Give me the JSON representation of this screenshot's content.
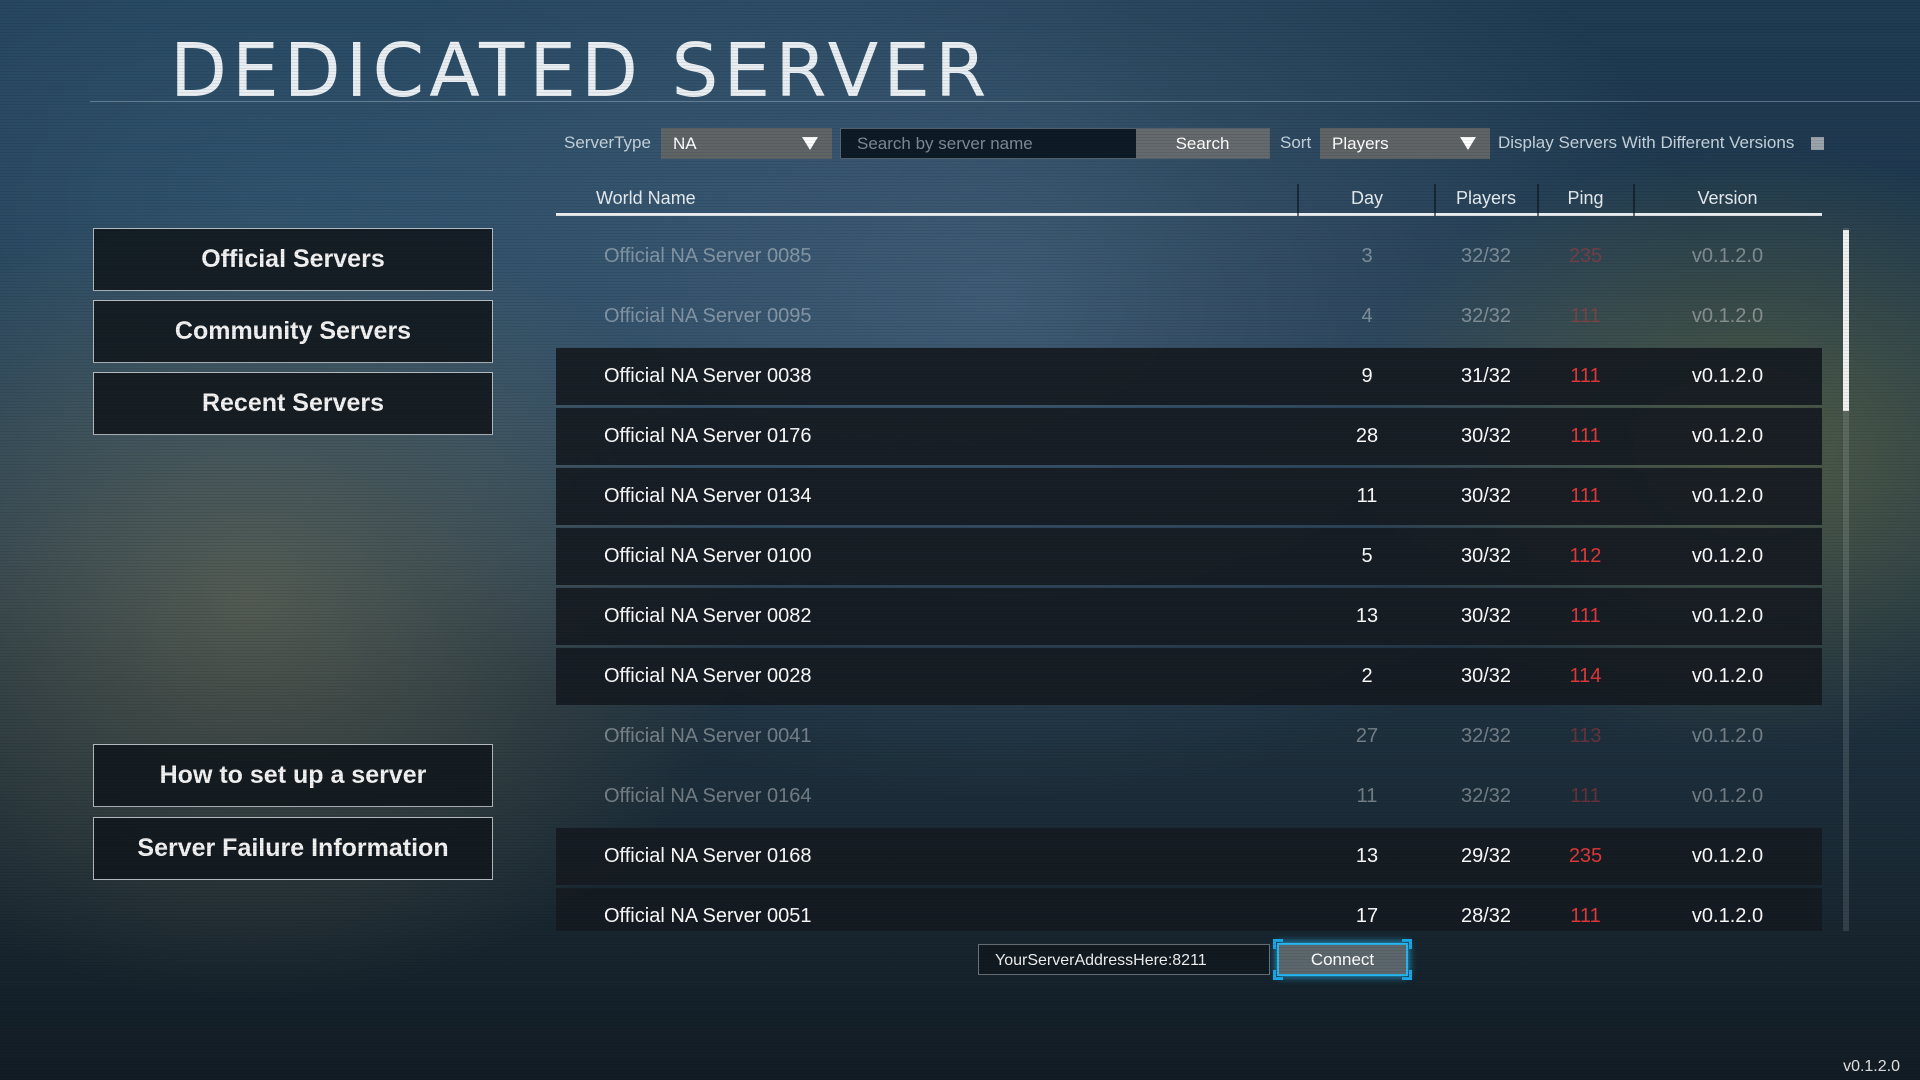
{
  "title": "DEDICATED SERVER",
  "nav": {
    "official": "Official Servers",
    "community": "Community Servers",
    "recent": "Recent Servers",
    "howto": "How to set up a server",
    "failure": "Server Failure Information"
  },
  "toolbar": {
    "server_type_label": "ServerType",
    "server_type_value": "NA",
    "search_placeholder": "Search by server name",
    "search_button": "Search",
    "sort_label": "Sort",
    "sort_value": "Players",
    "display_versions_label": "Display Servers With Different Versions",
    "display_versions_checked": false
  },
  "table": {
    "headers": {
      "name": "World Name",
      "day": "Day",
      "players": "Players",
      "ping": "Ping",
      "version": "Version"
    },
    "rows": [
      {
        "name": "Official NA Server 0085",
        "day": "3",
        "players": "32/32",
        "ping": "235",
        "version": "v0.1.2.0",
        "full": true
      },
      {
        "name": "Official NA Server 0095",
        "day": "4",
        "players": "32/32",
        "ping": "111",
        "version": "v0.1.2.0",
        "full": true
      },
      {
        "name": "Official NA Server 0038",
        "day": "9",
        "players": "31/32",
        "ping": "111",
        "version": "v0.1.2.0",
        "full": false
      },
      {
        "name": "Official NA Server 0176",
        "day": "28",
        "players": "30/32",
        "ping": "111",
        "version": "v0.1.2.0",
        "full": false
      },
      {
        "name": "Official NA Server 0134",
        "day": "11",
        "players": "30/32",
        "ping": "111",
        "version": "v0.1.2.0",
        "full": false
      },
      {
        "name": "Official NA Server 0100",
        "day": "5",
        "players": "30/32",
        "ping": "112",
        "version": "v0.1.2.0",
        "full": false
      },
      {
        "name": "Official NA Server 0082",
        "day": "13",
        "players": "30/32",
        "ping": "111",
        "version": "v0.1.2.0",
        "full": false
      },
      {
        "name": "Official NA Server 0028",
        "day": "2",
        "players": "30/32",
        "ping": "114",
        "version": "v0.1.2.0",
        "full": false
      },
      {
        "name": "Official NA Server 0041",
        "day": "27",
        "players": "32/32",
        "ping": "113",
        "version": "v0.1.2.0",
        "full": true
      },
      {
        "name": "Official NA Server 0164",
        "day": "11",
        "players": "32/32",
        "ping": "111",
        "version": "v0.1.2.0",
        "full": true
      },
      {
        "name": "Official NA Server 0168",
        "day": "13",
        "players": "29/32",
        "ping": "235",
        "version": "v0.1.2.0",
        "full": false
      },
      {
        "name": "Official NA Server 0051",
        "day": "17",
        "players": "28/32",
        "ping": "111",
        "version": "v0.1.2.0",
        "full": false
      }
    ]
  },
  "connect": {
    "address_value": "YourServerAddressHere:8211",
    "button": "Connect"
  },
  "footer_version": "v0.1.2.0",
  "colors": {
    "ping": "#e0383a",
    "accent": "#29b6f0"
  }
}
